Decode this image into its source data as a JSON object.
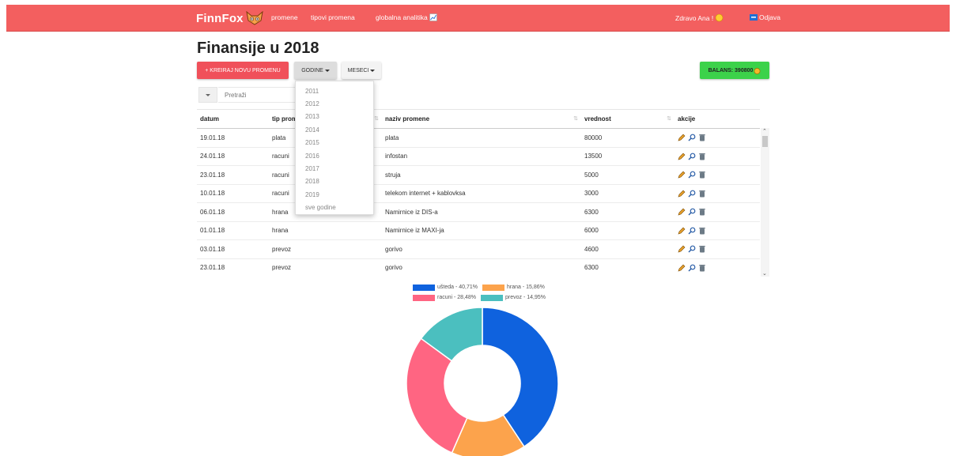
{
  "nav": {
    "brand": "FinnFox",
    "links": [
      "promene",
      "tipovi promena",
      "globalna analitika"
    ],
    "greeting": "Zdravo Ana !",
    "logout": "Odjava"
  },
  "page": {
    "title": "Finansije u 2018"
  },
  "toolbar": {
    "create_label": "+ KREIRAJ NOVU PROMENU",
    "years_label": "GODINE",
    "months_label": "MESECI",
    "balance_label": "BALANS: 390800"
  },
  "search": {
    "placeholder": "Pretraži"
  },
  "years_dropdown": [
    "2011",
    "2012",
    "2013",
    "2014",
    "2015",
    "2016",
    "2017",
    "2018",
    "2019",
    "sve godine"
  ],
  "table": {
    "headers": [
      "datum",
      "tip promene",
      "naziv promene",
      "vrednost",
      "akcije"
    ],
    "rows": [
      [
        "19.01.18",
        "plata",
        "plata",
        "80000"
      ],
      [
        "24.01.18",
        "racuni",
        "infostan",
        "13500"
      ],
      [
        "23.01.18",
        "racuni",
        "struja",
        "5000"
      ],
      [
        "10.01.18",
        "racuni",
        "telekom internet + kablovksa",
        "3000"
      ],
      [
        "06.01.18",
        "hrana",
        "Namirnice iz DIS-a",
        "6300"
      ],
      [
        "01.01.18",
        "hrana",
        "Namirnice iz MAXI-ja",
        "6000"
      ],
      [
        "03.01.18",
        "prevoz",
        "gorivo",
        "4600"
      ],
      [
        "23.01.18",
        "prevoz",
        "gorivo",
        "6300"
      ]
    ]
  },
  "chart_data": {
    "type": "pie",
    "labels": [
      "ušteda",
      "hrana",
      "racuni",
      "prevoz"
    ],
    "values": [
      40.71,
      15.86,
      28.48,
      14.95
    ],
    "legend_labels": [
      "ušteda - 40,71%",
      "hrana - 15,86%",
      "racuni - 28,48%",
      "prevoz - 14,95%"
    ],
    "colors": [
      "#0f62de",
      "#fca34c",
      "#ff6582",
      "#4bbfbf"
    ],
    "legend": "top"
  },
  "colors": {
    "navbar": "#f35f5f",
    "create_button": "#f0505a",
    "balance_button": "#3cd24a"
  }
}
